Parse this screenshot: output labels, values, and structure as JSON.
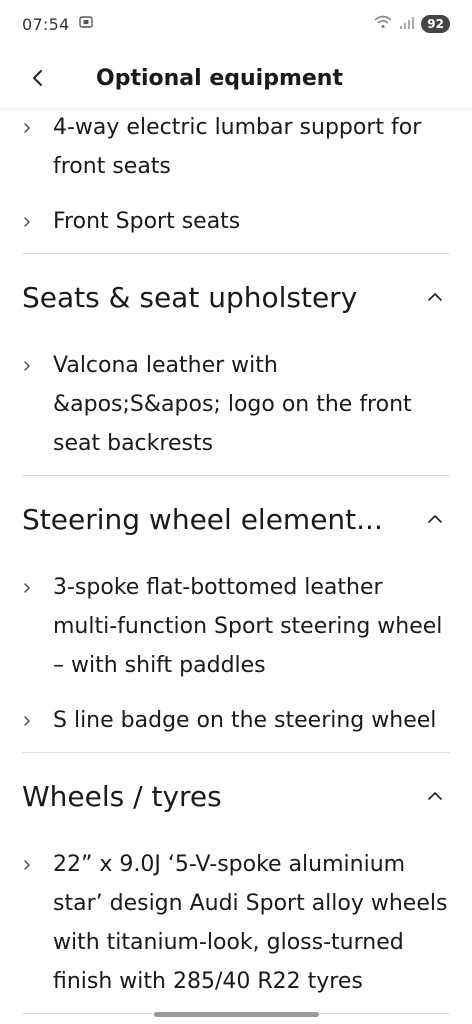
{
  "status_bar": {
    "time": "07:54",
    "battery": "92"
  },
  "header": {
    "title": "Optional equipment"
  },
  "top_items": [
    "4-way electric lumbar support for front seats",
    "Front Sport seats"
  ],
  "sections": [
    {
      "title": "Seats & seat upholstery",
      "items": [
        "Valcona leather with &apos;S&apos; logo on the front seat backrests"
      ]
    },
    {
      "title": "Steering wheel element...",
      "items": [
        "3-spoke flat-bottomed leather multi-function Sport steering wheel – with shift paddles",
        "S line badge on the steering wheel"
      ]
    },
    {
      "title": "Wheels / tyres",
      "items": [
        "22” x 9.0J ‘5-V-spoke aluminium star’ design Audi Sport alloy wheels with titanium-look, gloss-turned finish with 285/40 R22 tyres"
      ]
    }
  ],
  "icons": {
    "back": "chevron-left-icon",
    "item": "chevron-right-icon",
    "collapse": "chevron-up-icon"
  }
}
